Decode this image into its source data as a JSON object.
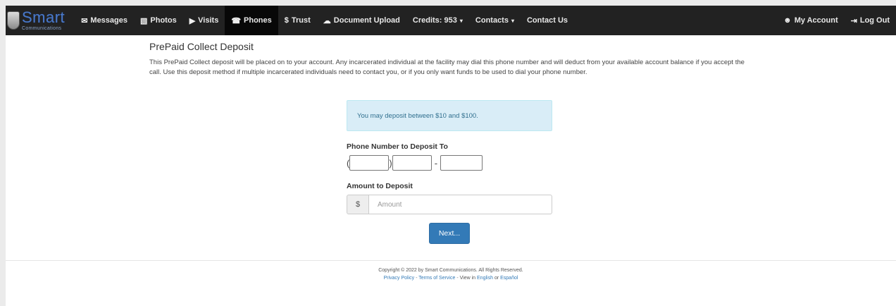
{
  "brand": {
    "name": "Smart",
    "sub": "Communications"
  },
  "nav": {
    "items": [
      {
        "key": "messages",
        "icon": "✉",
        "label": "Messages"
      },
      {
        "key": "photos",
        "icon": "▧",
        "label": "Photos"
      },
      {
        "key": "visits",
        "icon": "▶",
        "label": "Visits"
      },
      {
        "key": "phones",
        "icon": "☎",
        "label": "Phones"
      },
      {
        "key": "trust",
        "icon": "$",
        "label": "Trust"
      },
      {
        "key": "upload",
        "icon": "☁",
        "label": "Document Upload"
      },
      {
        "key": "credits",
        "icon": "",
        "label": "Credits: 953"
      },
      {
        "key": "contacts",
        "icon": "",
        "label": "Contacts"
      },
      {
        "key": "contact-us",
        "icon": "",
        "label": "Contact Us"
      }
    ],
    "right": [
      {
        "key": "account",
        "icon": "☻",
        "label": "My Account"
      },
      {
        "key": "logout",
        "icon": "⇥",
        "label": "Log Out"
      }
    ],
    "caret": "▾"
  },
  "page": {
    "title": "PrePaid Collect Deposit",
    "description": "This PrePaid Collect deposit will be placed on to your account. Any incarcerated individual at the facility may dial this phone number and will deduct from your available account balance if you accept the call. Use this deposit method if multiple incarcerated individuals need to contact you, or if you only want funds to be used to dial your phone number."
  },
  "form": {
    "alert": "You may deposit between $10 and $100.",
    "phone_label": "Phone Number to Deposit To",
    "phone_open": "(",
    "phone_close": ")",
    "phone_dash": "-",
    "area_code_value": "",
    "prefix_value": "",
    "line_value": "",
    "amount_label": "Amount to Deposit",
    "currency_symbol": "$",
    "amount_placeholder": "Amount",
    "amount_value": "",
    "next_label": "Next..."
  },
  "footer": {
    "copyright": "Copyright © 2022 by Smart Communications. All Rights Reserved.",
    "privacy": "Privacy Policy",
    "terms": "Terms of Service",
    "view_in": "View in",
    "english": "English",
    "or": "or",
    "espanol": "Español",
    "sep": " - "
  },
  "colors": {
    "navbar": "#222222",
    "nav_active": "#080808",
    "brand_blue": "#4a78c8",
    "alert_bg": "#d9edf7",
    "alert_text": "#31708f",
    "primary_button": "#337ab7"
  }
}
